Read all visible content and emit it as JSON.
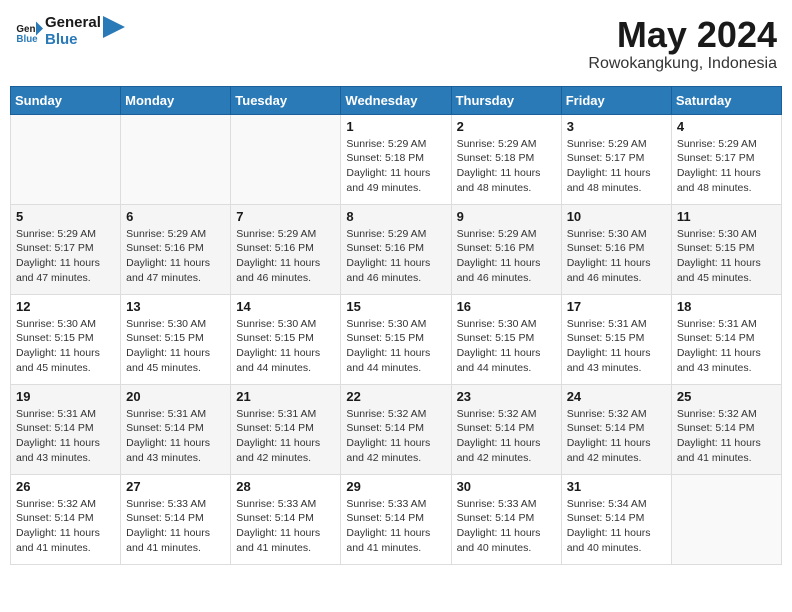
{
  "header": {
    "logo_line1": "General",
    "logo_line2": "Blue",
    "month_year": "May 2024",
    "location": "Rowokangkung, Indonesia"
  },
  "weekdays": [
    "Sunday",
    "Monday",
    "Tuesday",
    "Wednesday",
    "Thursday",
    "Friday",
    "Saturday"
  ],
  "weeks": [
    [
      {
        "day": "",
        "info": ""
      },
      {
        "day": "",
        "info": ""
      },
      {
        "day": "",
        "info": ""
      },
      {
        "day": "1",
        "info": "Sunrise: 5:29 AM\nSunset: 5:18 PM\nDaylight: 11 hours\nand 49 minutes."
      },
      {
        "day": "2",
        "info": "Sunrise: 5:29 AM\nSunset: 5:18 PM\nDaylight: 11 hours\nand 48 minutes."
      },
      {
        "day": "3",
        "info": "Sunrise: 5:29 AM\nSunset: 5:17 PM\nDaylight: 11 hours\nand 48 minutes."
      },
      {
        "day": "4",
        "info": "Sunrise: 5:29 AM\nSunset: 5:17 PM\nDaylight: 11 hours\nand 48 minutes."
      }
    ],
    [
      {
        "day": "5",
        "info": "Sunrise: 5:29 AM\nSunset: 5:17 PM\nDaylight: 11 hours\nand 47 minutes."
      },
      {
        "day": "6",
        "info": "Sunrise: 5:29 AM\nSunset: 5:16 PM\nDaylight: 11 hours\nand 47 minutes."
      },
      {
        "day": "7",
        "info": "Sunrise: 5:29 AM\nSunset: 5:16 PM\nDaylight: 11 hours\nand 46 minutes."
      },
      {
        "day": "8",
        "info": "Sunrise: 5:29 AM\nSunset: 5:16 PM\nDaylight: 11 hours\nand 46 minutes."
      },
      {
        "day": "9",
        "info": "Sunrise: 5:29 AM\nSunset: 5:16 PM\nDaylight: 11 hours\nand 46 minutes."
      },
      {
        "day": "10",
        "info": "Sunrise: 5:30 AM\nSunset: 5:16 PM\nDaylight: 11 hours\nand 46 minutes."
      },
      {
        "day": "11",
        "info": "Sunrise: 5:30 AM\nSunset: 5:15 PM\nDaylight: 11 hours\nand 45 minutes."
      }
    ],
    [
      {
        "day": "12",
        "info": "Sunrise: 5:30 AM\nSunset: 5:15 PM\nDaylight: 11 hours\nand 45 minutes."
      },
      {
        "day": "13",
        "info": "Sunrise: 5:30 AM\nSunset: 5:15 PM\nDaylight: 11 hours\nand 45 minutes."
      },
      {
        "day": "14",
        "info": "Sunrise: 5:30 AM\nSunset: 5:15 PM\nDaylight: 11 hours\nand 44 minutes."
      },
      {
        "day": "15",
        "info": "Sunrise: 5:30 AM\nSunset: 5:15 PM\nDaylight: 11 hours\nand 44 minutes."
      },
      {
        "day": "16",
        "info": "Sunrise: 5:30 AM\nSunset: 5:15 PM\nDaylight: 11 hours\nand 44 minutes."
      },
      {
        "day": "17",
        "info": "Sunrise: 5:31 AM\nSunset: 5:15 PM\nDaylight: 11 hours\nand 43 minutes."
      },
      {
        "day": "18",
        "info": "Sunrise: 5:31 AM\nSunset: 5:14 PM\nDaylight: 11 hours\nand 43 minutes."
      }
    ],
    [
      {
        "day": "19",
        "info": "Sunrise: 5:31 AM\nSunset: 5:14 PM\nDaylight: 11 hours\nand 43 minutes."
      },
      {
        "day": "20",
        "info": "Sunrise: 5:31 AM\nSunset: 5:14 PM\nDaylight: 11 hours\nand 43 minutes."
      },
      {
        "day": "21",
        "info": "Sunrise: 5:31 AM\nSunset: 5:14 PM\nDaylight: 11 hours\nand 42 minutes."
      },
      {
        "day": "22",
        "info": "Sunrise: 5:32 AM\nSunset: 5:14 PM\nDaylight: 11 hours\nand 42 minutes."
      },
      {
        "day": "23",
        "info": "Sunrise: 5:32 AM\nSunset: 5:14 PM\nDaylight: 11 hours\nand 42 minutes."
      },
      {
        "day": "24",
        "info": "Sunrise: 5:32 AM\nSunset: 5:14 PM\nDaylight: 11 hours\nand 42 minutes."
      },
      {
        "day": "25",
        "info": "Sunrise: 5:32 AM\nSunset: 5:14 PM\nDaylight: 11 hours\nand 41 minutes."
      }
    ],
    [
      {
        "day": "26",
        "info": "Sunrise: 5:32 AM\nSunset: 5:14 PM\nDaylight: 11 hours\nand 41 minutes."
      },
      {
        "day": "27",
        "info": "Sunrise: 5:33 AM\nSunset: 5:14 PM\nDaylight: 11 hours\nand 41 minutes."
      },
      {
        "day": "28",
        "info": "Sunrise: 5:33 AM\nSunset: 5:14 PM\nDaylight: 11 hours\nand 41 minutes."
      },
      {
        "day": "29",
        "info": "Sunrise: 5:33 AM\nSunset: 5:14 PM\nDaylight: 11 hours\nand 41 minutes."
      },
      {
        "day": "30",
        "info": "Sunrise: 5:33 AM\nSunset: 5:14 PM\nDaylight: 11 hours\nand 40 minutes."
      },
      {
        "day": "31",
        "info": "Sunrise: 5:34 AM\nSunset: 5:14 PM\nDaylight: 11 hours\nand 40 minutes."
      },
      {
        "day": "",
        "info": ""
      }
    ]
  ]
}
